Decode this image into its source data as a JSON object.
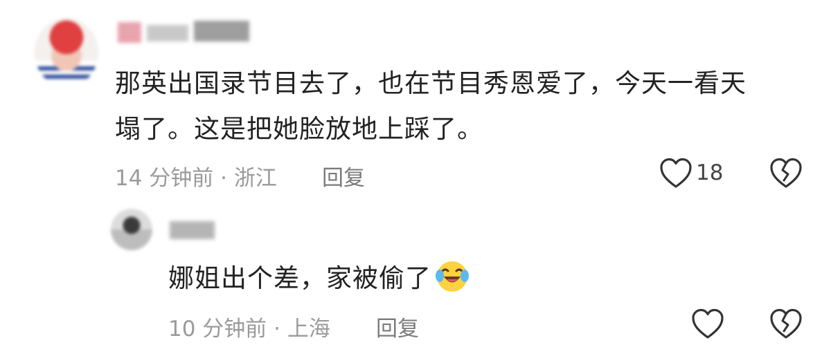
{
  "comments": [
    {
      "text_line1": "那英出国录节目去了，也在节目秀恩爱了，今天一看天",
      "text_line2": "塌了。这是把她脸放地上踩了。",
      "meta": "14 分钟前 · 浙江",
      "reply_label": "回复",
      "like_count": "18"
    },
    {
      "text": "娜姐出个差，家被偷了",
      "emoji": "crying-laughing-emoji",
      "meta": "10 分钟前 · 上海",
      "reply_label": "回复",
      "like_count": ""
    }
  ],
  "icons": {
    "like": "heart-outline-icon",
    "dislike": "broken-heart-icon"
  },
  "colors": {
    "text": "#222222",
    "meta": "#9a9a9a",
    "icon": "#333333"
  }
}
